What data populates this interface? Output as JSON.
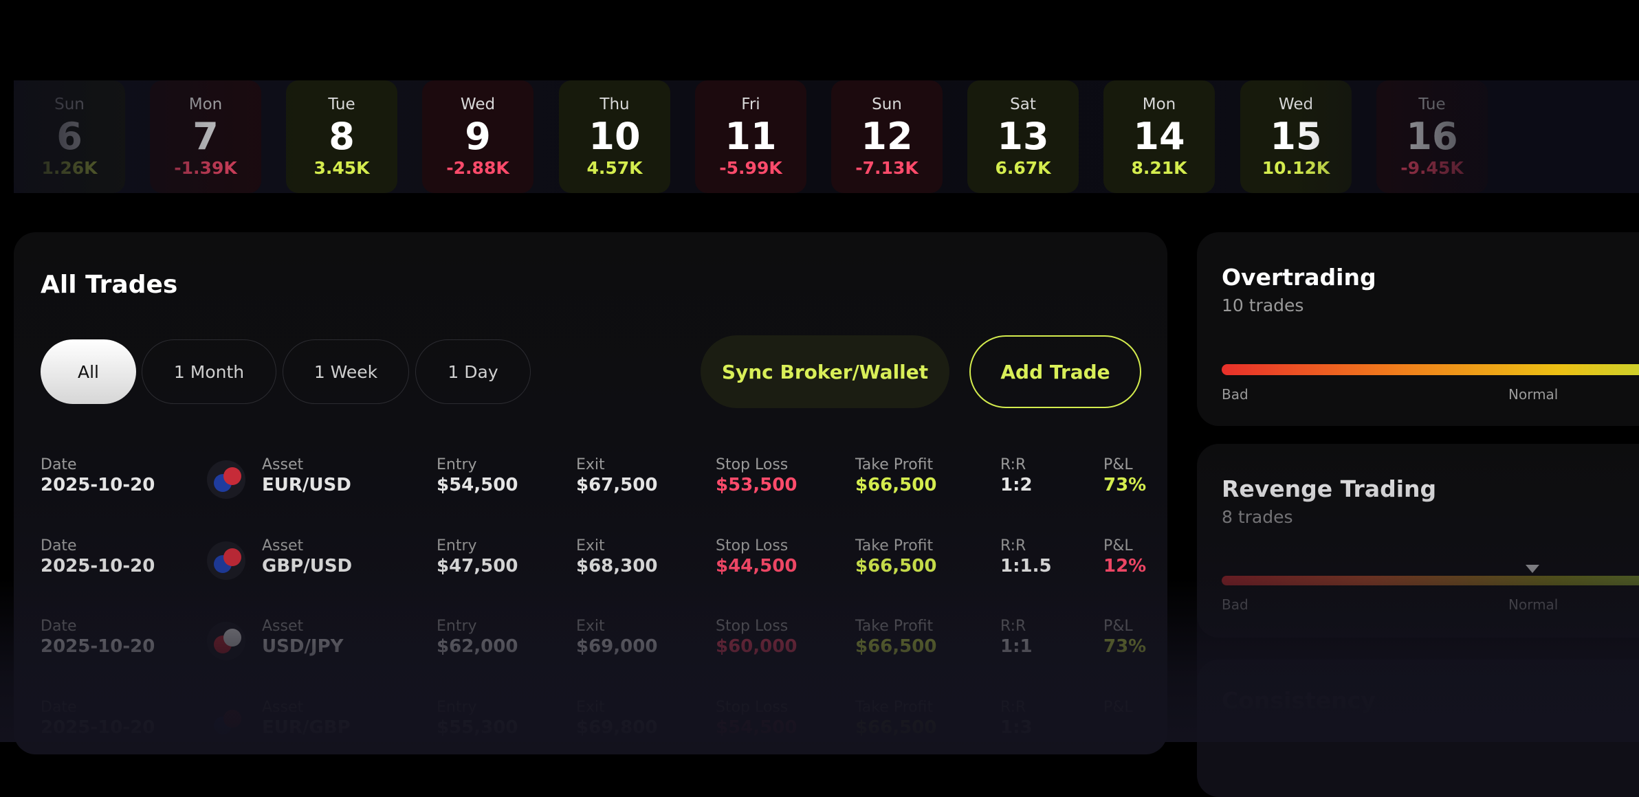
{
  "calendar": {
    "days": [
      {
        "day": "Sun",
        "date": "6",
        "value": "1.26K",
        "sign": "pos"
      },
      {
        "day": "Mon",
        "date": "7",
        "value": "-1.39K",
        "sign": "neg"
      },
      {
        "day": "Tue",
        "date": "8",
        "value": "3.45K",
        "sign": "pos"
      },
      {
        "day": "Wed",
        "date": "9",
        "value": "-2.88K",
        "sign": "neg"
      },
      {
        "day": "Thu",
        "date": "10",
        "value": "4.57K",
        "sign": "pos"
      },
      {
        "day": "Fri",
        "date": "11",
        "value": "-5.99K",
        "sign": "neg"
      },
      {
        "day": "Sun",
        "date": "12",
        "value": "-7.13K",
        "sign": "neg"
      },
      {
        "day": "Sat",
        "date": "13",
        "value": "6.67K",
        "sign": "pos"
      },
      {
        "day": "Mon",
        "date": "14",
        "value": "8.21K",
        "sign": "pos"
      },
      {
        "day": "Wed",
        "date": "15",
        "value": "10.12K",
        "sign": "pos"
      },
      {
        "day": "Tue",
        "date": "16",
        "value": "-9.45K",
        "sign": "neg"
      }
    ]
  },
  "trades": {
    "title": "All Trades",
    "filters": [
      "All",
      "1 Month",
      "1 Week",
      "1 Day"
    ],
    "sync_label": "Sync Broker/Wallet",
    "add_label": "Add Trade",
    "labels": {
      "date": "Date",
      "asset": "Asset",
      "entry": "Entry",
      "exit": "Exit",
      "stop_loss": "Stop Loss",
      "take_profit": "Take Profit",
      "rr": "R:R",
      "pl": "P&L"
    },
    "rows": [
      {
        "date": "2025-10-20",
        "asset": "EUR/USD",
        "entry": "$54,500",
        "exit": "$67,500",
        "stop_loss": "$53,500",
        "take_profit": "$66,500",
        "rr": "1:2",
        "pl": "73%",
        "pl_sign": "pos"
      },
      {
        "date": "2025-10-20",
        "asset": "GBP/USD",
        "entry": "$47,500",
        "exit": "$68,300",
        "stop_loss": "$44,500",
        "take_profit": "$66,500",
        "rr": "1:1.5",
        "pl": "12%",
        "pl_sign": "neg"
      },
      {
        "date": "2025-10-20",
        "asset": "USD/JPY",
        "entry": "$62,000",
        "exit": "$69,000",
        "stop_loss": "$60,000",
        "take_profit": "$66,500",
        "rr": "1:1",
        "pl": "73%",
        "pl_sign": "pos"
      },
      {
        "date": "2025-10-20",
        "asset": "EUR/GBP",
        "entry": "$55,300",
        "exit": "$69,800",
        "stop_loss": "$54,500",
        "take_profit": "$66,500",
        "rr": "1:3",
        "pl": "",
        "pl_sign": "pos"
      }
    ]
  },
  "insights": {
    "overtrading": {
      "title": "Overtrading",
      "subtitle": "10 trades",
      "bad": "Bad",
      "normal": "Normal"
    },
    "revenge": {
      "title": "Revenge Trading",
      "subtitle": "8 trades",
      "bad": "Bad",
      "normal": "Normal"
    },
    "consistency": {
      "title": "Consistency"
    }
  },
  "colors": {
    "accent": "#d4ec4e",
    "negative": "#ff4b6b",
    "background": "#000000"
  }
}
